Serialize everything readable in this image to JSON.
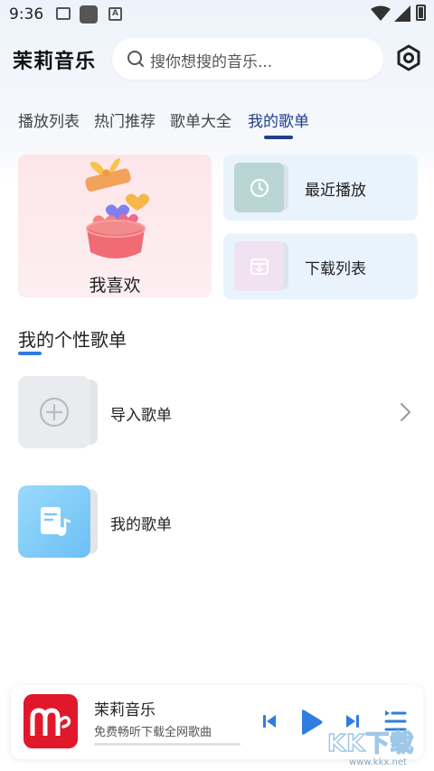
{
  "status_bar": {
    "time": "9:36",
    "icons": [
      "gallery-icon",
      "square-app-icon",
      "a-font-icon",
      "wifi-icon",
      "signal-icon",
      "battery-icon"
    ]
  },
  "header": {
    "app_title": "茉莉音乐",
    "search_placeholder": "搜你想搜的音乐...",
    "settings_icon": "settings-hex-icon"
  },
  "tabs": [
    {
      "label": "播放列表",
      "active": false
    },
    {
      "label": "热门推荐",
      "active": false
    },
    {
      "label": "歌单大全",
      "active": false
    },
    {
      "label": "我的歌单",
      "active": true
    }
  ],
  "favorites": {
    "label": "我喜欢",
    "illustration": "gift-box-hearts-icon"
  },
  "quick_cards": {
    "recent": {
      "label": "最近播放",
      "icon": "clock-icon"
    },
    "download": {
      "label": "下载列表",
      "icon": "download-box-icon"
    }
  },
  "section": {
    "title": "我的个性歌单"
  },
  "playlists": {
    "import": {
      "label": "导入歌单",
      "icon": "plus-circle-icon"
    },
    "mine": {
      "label": "我的歌单",
      "icon": "music-doc-icon"
    }
  },
  "player": {
    "title": "茉莉音乐",
    "subtitle": "免费畅听下载全网歌曲",
    "progress": 0.0
  },
  "watermark": {
    "main": "KK下载",
    "url": "www.kkx.net"
  },
  "colors": {
    "accent": "#2f7de0",
    "tab_active": "#1f3f8a",
    "logo_red": "#e0182b"
  }
}
